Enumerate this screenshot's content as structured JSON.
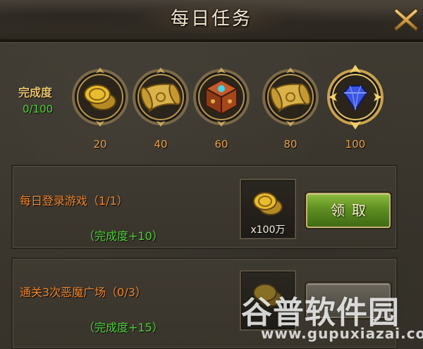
{
  "window": {
    "title": "每日任务",
    "close_icon": "close-x-icon"
  },
  "progress": {
    "label": "完成度",
    "value_text": "0/100",
    "current": 0,
    "max": 100
  },
  "milestones": [
    {
      "value": "20",
      "icon": "gold-coins-icon"
    },
    {
      "value": "40",
      "icon": "scroll-icon"
    },
    {
      "value": "60",
      "icon": "treasure-box-icon"
    },
    {
      "value": "80",
      "icon": "scroll-icon"
    },
    {
      "value": "100",
      "icon": "blue-diamond-icon"
    }
  ],
  "tasks": [
    {
      "name": "每日登录游戏（1/1）",
      "reward": "（完成度+10）",
      "item_icon": "gold-coins-icon",
      "item_count": "x100万",
      "button_label": "领取"
    },
    {
      "name": "通关3次恶魔广场（0/3）",
      "reward": "（完成度+15）",
      "item_icon": "gold-coins-icon",
      "button_label": ""
    }
  ],
  "watermark": {
    "brand": "谷普软件园",
    "url": "www.gupuxiazai.com"
  },
  "colors": {
    "milestone_value": "#e8a046",
    "task_name": "#f0852b",
    "reward_text": "#4fd039",
    "progress_label": "#e7c36a",
    "button_green": "#5f8f22"
  }
}
